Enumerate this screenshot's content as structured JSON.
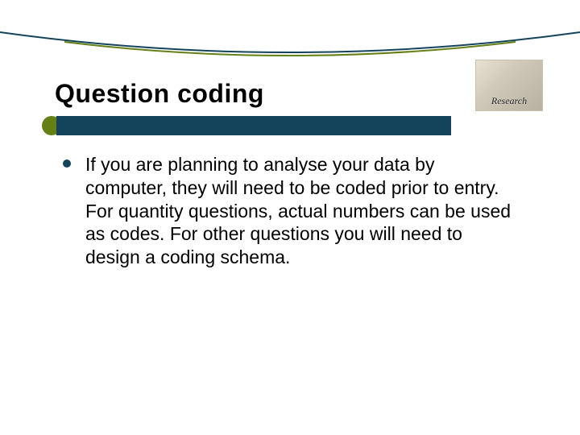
{
  "slide": {
    "title": "Question coding",
    "corner_label": "Research",
    "body": {
      "items": [
        {
          "text": "If you are planning to analyse your data by computer, they will need to be coded prior to entry. For quantity questions, actual numbers can be used as codes. For other questions you will need to design a coding schema."
        }
      ]
    }
  },
  "colors": {
    "accent_bar": "#14445c",
    "accent_dot": "#647f13"
  }
}
